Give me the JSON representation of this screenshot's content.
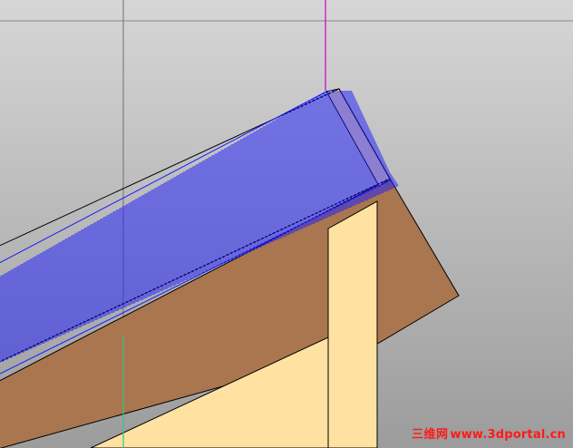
{
  "viewport": {
    "background_gradient_top": "#d6d6d6",
    "background_gradient_bottom": "#9c9c9c",
    "axis_vertical_color": "#cc00cc",
    "axis_green_color": "#34c28a",
    "guide_line_color": "#707070"
  },
  "model": {
    "roof_side_color": "#a9764f",
    "wall_color": "#ffe2a2",
    "hatch_color": "#1a1aff",
    "edge_color": "#000000"
  },
  "watermark": {
    "cn": "三维网",
    "url": "www.3dportal.cn"
  }
}
